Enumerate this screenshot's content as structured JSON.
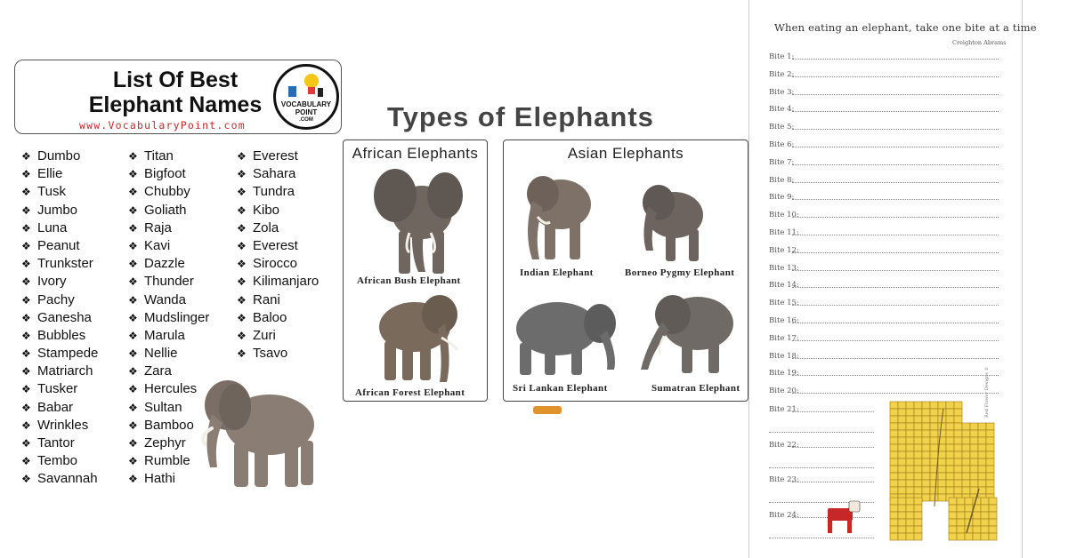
{
  "names_list": {
    "title_line1": "List Of Best",
    "title_line2": "Elephant Names",
    "website": "www.VocabularyPoint.com",
    "logo": {
      "line1": "VOCABULARY",
      "line2": "POINT",
      "line3": ".COM"
    },
    "bullet": "❖",
    "columns": [
      [
        "Dumbo",
        "Ellie",
        "Tusk",
        "Jumbo",
        "Luna",
        "Peanut",
        "Trunkster",
        "Ivory",
        "Pachy",
        "Ganesha",
        "Bubbles",
        "Stampede",
        "Matriarch",
        "Tusker",
        "Babar",
        "Wrinkles",
        "Tantor",
        "Tembo",
        "Savannah"
      ],
      [
        "Titan",
        "Bigfoot",
        "Chubby",
        "Goliath",
        "Raja",
        "Kavi",
        "Dazzle",
        "Thunder",
        "Wanda",
        "Mudslinger",
        "Marula",
        "Nellie",
        "Zara",
        "Hercules",
        "Sultan",
        "Bamboo",
        "Zephyr",
        "Rumble",
        "Hathi"
      ],
      [
        "Everest",
        "Sahara",
        "Tundra",
        "Kibo",
        "Zola",
        "Everest",
        "Sirocco",
        "Kilimanjaro",
        "Rani",
        "Baloo",
        "Zuri",
        "Tsavo"
      ]
    ]
  },
  "types": {
    "title": "Types of Elephants",
    "african": {
      "title": "African Elephants",
      "items": [
        "African Bush Elephant",
        "African Forest Elephant"
      ]
    },
    "asian": {
      "title": "Asian Elephants",
      "items": [
        "Indian Elephant",
        "Borneo Pygmy Elephant",
        "Sri Lankan Elephant",
        "Sumatran Elephant"
      ]
    }
  },
  "worksheet": {
    "quote": "When eating an elephant, take one bite at a time",
    "author": "Creighton Abrams",
    "bites": [
      "Bite 1:",
      "Bite 2:",
      "Bite 3:",
      "Bite 4:",
      "Bite 5:",
      "Bite 6:",
      "Bite 7:",
      "Bite 8:",
      "Bite 9:",
      "Bite 10:",
      "Bite 11:",
      "Bite 12:",
      "Bite 13:",
      "Bite 14:",
      "Bite 15:",
      "Bite 16:",
      "Bite 17:",
      "Bite 18:",
      "Bite 19:",
      "Bite 20:",
      "Bite 21:",
      "Bite 22:",
      "Bite 23:",
      "Bite 24:"
    ],
    "credit": "Red Flower Designs ©"
  },
  "colors": {
    "website_red": "#c62828",
    "elephant_gray": "#7a6e66",
    "cube_yellow": "#f2d24b",
    "dog_red": "#c62828"
  }
}
